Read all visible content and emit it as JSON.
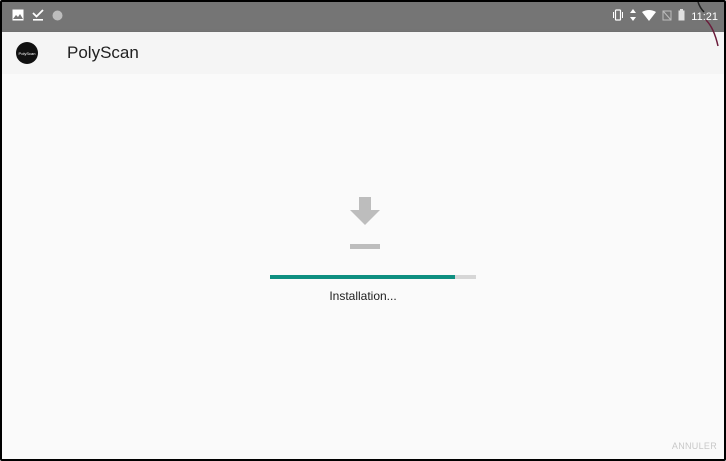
{
  "status_bar": {
    "time": "11:21",
    "left_icons": [
      "image-icon",
      "download-done-icon",
      "circle-icon"
    ],
    "right_icons": [
      "vibrate-icon",
      "data-arrows-icon",
      "wifi-icon",
      "no-sim-icon",
      "battery-icon"
    ]
  },
  "app_bar": {
    "logo_text": "PolyScan",
    "title": "PolyScan"
  },
  "install": {
    "icon": "download-icon",
    "progress": 0.9,
    "status_text": "Installation..."
  },
  "actions": {
    "cancel_label": "ANNULER"
  },
  "colors": {
    "status_bar": "#757575",
    "app_bar": "#f5f5f5",
    "progress_fill": "#0e8f80",
    "progress_track": "#d6d6d6",
    "icon_gray": "#bdbdbd",
    "cancel_text": "#c8c8c8"
  }
}
